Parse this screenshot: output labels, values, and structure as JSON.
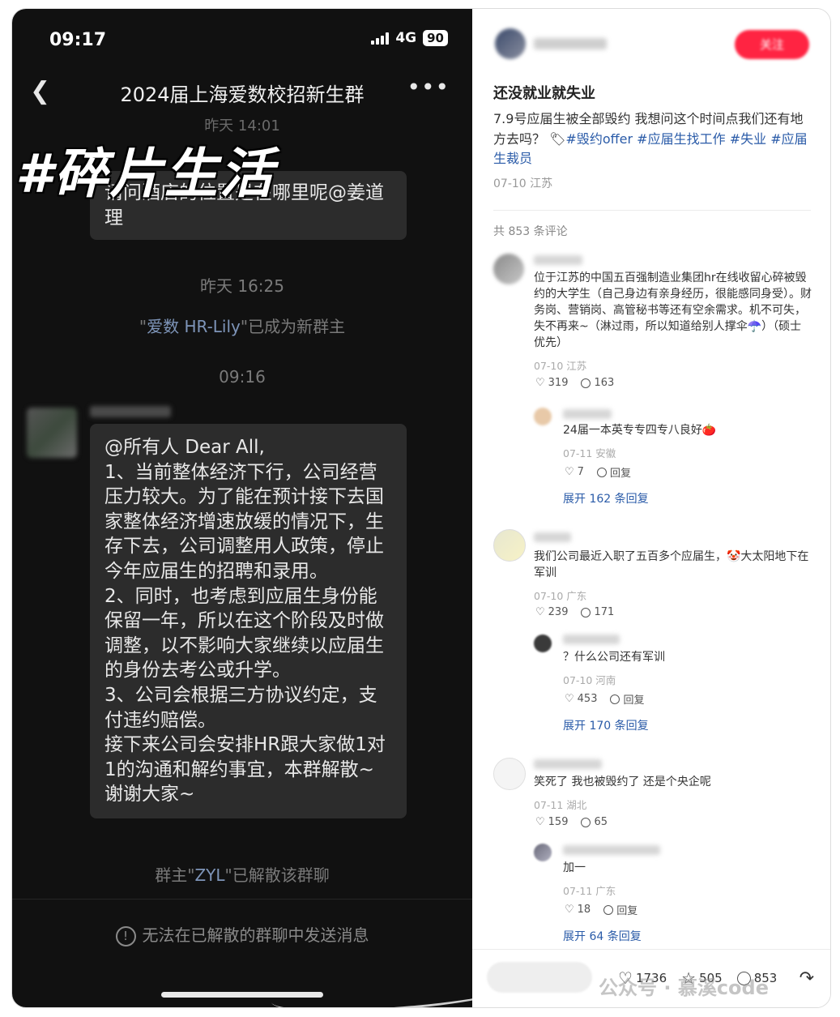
{
  "phone": {
    "status": {
      "time": "09:17",
      "network": "4G",
      "battery": "90"
    },
    "chat_title": "2024届上海爱数校招新生群",
    "watermark": "#碎片生活",
    "partial_time_top": "昨天 14:01",
    "first_bubble": "请问酒店的位置是在哪里呢@姜道理",
    "time_1": "昨天 16:25",
    "system_1_prefix": "\"",
    "system_1_name": "爱数 HR-Lily",
    "system_1_suffix": "\"已成为新群主",
    "time_2": "09:16",
    "announcement": [
      "@所有人 Dear All,",
      "1、当前整体经济下行，公司经营压力较大。为了能在预计接下去国家整体经济增速放缓的情况下，生存下去，公司调整用人政策，停止今年应届生的招聘和录用。",
      "2、同时，也考虑到应届生身份能保留一年，所以在这个阶段及时做调整，以不影响大家继续以应届生的身份去考公或升学。",
      "3、公司会根据三方协议约定，支付违约赔偿。",
      "接下来公司会安排HR跟大家做1对1的沟通和解约事宜，本群解散~谢谢大家~"
    ],
    "system_2_prefix": "群主\"",
    "system_2_name": "ZYL",
    "system_2_suffix": "\"已解散该群聊",
    "footer_note": "无法在已解散的群聊中发送消息"
  },
  "panel": {
    "follow_label": "关注",
    "post_title": "还没就业就失业",
    "post_text": "7.9号应届生被全部毁约 我想问这个时间点我们还有地方去吗？",
    "tags": [
      "#毁约offer",
      "#应届生找工作",
      "#失业",
      "#应届生裁员"
    ],
    "post_meta": "07-10 江苏",
    "comment_count": "共 853 条评论",
    "comments": [
      {
        "text": "位于江苏的中国五百强制造业集团hr在线收留心碎被毁约的大学生（自己身边有亲身经历，很能感同身受）。财务岗、营销岗、高管秘书等还有空余需求。机不可失，失不再来~（淋过雨，所以知道给别人撑伞☂️）（硕士优先）",
        "meta": "07-10 江苏",
        "likes": "319",
        "replies": "163",
        "reply": {
          "text": "24届一本英专专四专八良好🍅",
          "meta": "07-11 安徽",
          "likes": "7",
          "reply_label": "回复"
        },
        "expand": "展开 162 条回复"
      },
      {
        "text": "我们公司最近入职了五百多个应届生，🤡大太阳地下在军训",
        "meta": "07-10 广东",
        "likes": "239",
        "replies": "171",
        "reply": {
          "text": "？什么公司还有军训",
          "meta": "07-10 河南",
          "likes": "453",
          "reply_label": "回复"
        },
        "expand": "展开 170 条回复"
      },
      {
        "text": "笑死了 我也被毁约了 还是个央企呢",
        "meta": "07-11 湖北",
        "likes": "159",
        "replies": "65",
        "reply": {
          "text": "加一",
          "meta": "07-11 广东",
          "likes": "18",
          "reply_label": "回复"
        },
        "expand": "展开 64 条回复"
      }
    ],
    "bottom": {
      "likes": "1736",
      "stars": "505",
      "comments": "853"
    },
    "wechat_watermark": "公众号 · 慕溪code",
    "colors": {
      "accent": "#ff2442",
      "link": "#2a5ba8"
    }
  }
}
